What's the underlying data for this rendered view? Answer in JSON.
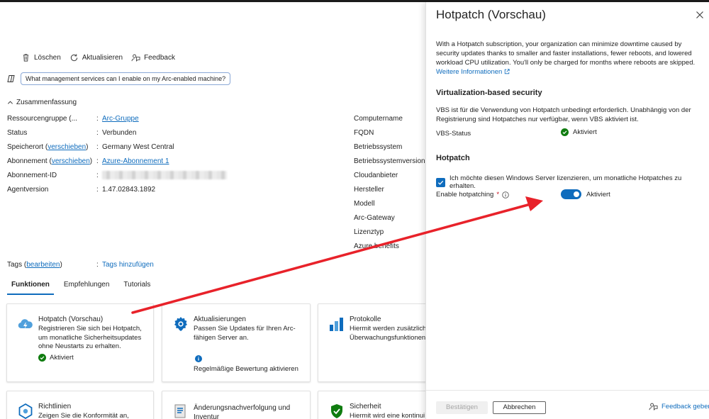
{
  "toolbar": {
    "delete_label": "Löschen",
    "refresh_label": "Aktualisieren",
    "feedback_label": "Feedback"
  },
  "copilot": {
    "prompt": "What management services can I enable on my Arc-enabled machine?"
  },
  "summary": {
    "header": "Zusammenfassung",
    "left": [
      {
        "label": "Ressourcengruppe (...",
        "value": "Arc-Gruppe"
      },
      {
        "label": "Status",
        "value": "Verbunden"
      },
      {
        "label": "Speicherort",
        "label_link": "verschieben",
        "value": "Germany West Central"
      },
      {
        "label": "Abonnement",
        "label_link": "verschieben",
        "value": "Azure-Abonnement 1"
      },
      {
        "label": "Abonnement-ID",
        "value": ""
      },
      {
        "label": "Agentversion",
        "value": "1.47.02843.1892"
      }
    ],
    "right": [
      "Computername",
      "FQDN",
      "Betriebssystem",
      "Betriebssystemversion",
      "Cloudanbieter",
      "Hersteller",
      "Modell",
      "Arc-Gateway",
      "Lizenztyp",
      "Azure benefits"
    ],
    "tags": {
      "label": "Tags",
      "label_link": "bearbeiten",
      "value": "Tags hinzufügen"
    }
  },
  "tabs": [
    "Funktionen",
    "Empfehlungen",
    "Tutorials"
  ],
  "cards": {
    "hotpatch": {
      "title": "Hotpatch (Vorschau)",
      "desc": "Registrieren Sie sich bei Hotpatch, um monatliche Sicherheitsupdates ohne Neustarts zu erhalten.",
      "status": "Aktiviert"
    },
    "updates": {
      "title": "Aktualisierungen",
      "desc": "Passen Sie Updates für Ihren Arc-fähigen Server an.",
      "info": "Regelmäßige Bewertung aktivieren"
    },
    "logs": {
      "title": "Protokolle",
      "desc": "Hiermit werden zusätzliche Überwachungsfunktionen"
    },
    "policies": {
      "title": "Richtlinien",
      "desc": "Zeigen Sie die Konformität an,"
    },
    "changes": {
      "title": "Änderungsnachverfolgung und Inventur"
    },
    "security": {
      "title": "Sicherheit",
      "desc": "Hiermit wird eine kontinui"
    }
  },
  "panel": {
    "title": "Hotpatch (Vorschau)",
    "intro": "With a Hotpatch subscription, your organization can minimize downtime caused by security updates thanks to smaller and faster installations, fewer reboots, and lowered workload CPU utilization. You'll only be charged for months where reboots are skipped.",
    "intro_link": "Weitere Informationen",
    "vbs_heading": "Virtualization-based security",
    "vbs_text": "VBS ist für die Verwendung von Hotpatch unbedingt erforderlich. Unabhängig von der Registrierung sind Hotpatches nur verfügbar, wenn VBS aktiviert ist.",
    "vbs_status_label": "VBS-Status",
    "vbs_status_value": "Aktiviert",
    "hotpatch_heading": "Hotpatch",
    "license_checkbox": "Ich möchte diesen Windows Server lizenzieren, um monatliche Hotpatches zu erhalten.",
    "enable_label": "Enable hotpatching",
    "toggle_value": "Aktiviert",
    "confirm_button": "Bestätigen",
    "cancel_button": "Abbrechen",
    "feedback_link": "Feedback geben"
  },
  "colors": {
    "accent": "#0f6cbd",
    "success": "#107c10",
    "annotation_arrow": "#e8222a"
  }
}
